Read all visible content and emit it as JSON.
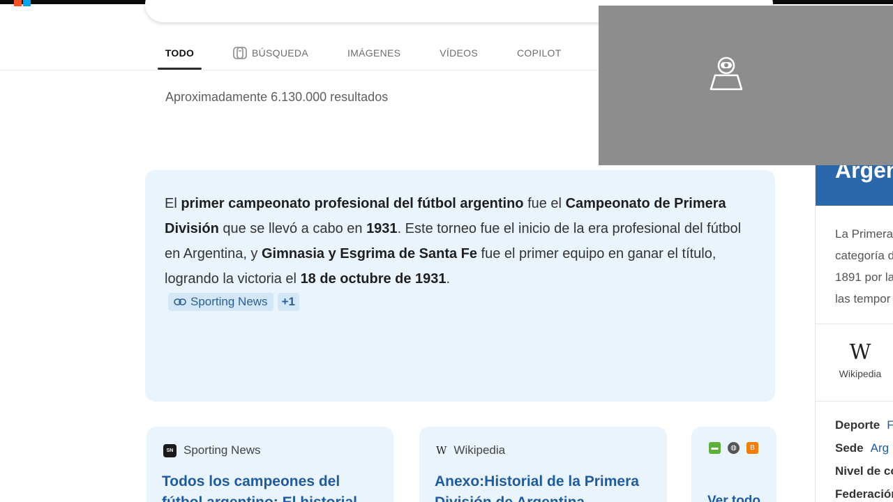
{
  "tabs": {
    "todo": "TODO",
    "busqueda": "BÚSQUEDA",
    "imagenes": "IMÁGENES",
    "videos": "VÍDEOS",
    "copilot": "COPILOT"
  },
  "results_count": "Aproximadamente 6.130.000 resultados",
  "answer": {
    "l1_a": "El ",
    "l1_b": "primer campeonato profesional del fútbol argentino",
    "l1_c": " fue el ",
    "l1_d": "Campeonato de Primera División",
    "l1_e": " que se llevó a cabo en ",
    "l1_f": "1931",
    "l1_g": ". Este torneo fue el inicio de la era profesional del fútbol en Argentina, y ",
    "l1_h": "Gimnasia y Esgrima de Santa Fe",
    "l1_i": " fue el primer equipo en ganar el título, logrando la victoria el ",
    "l1_j": "18 de octubre de 1931",
    "l1_k": ".",
    "citation": "Sporting News",
    "citation_more": "+1"
  },
  "cards": [
    {
      "badge": "SN",
      "source": "Sporting News",
      "title": "Todos los campeones del fútbol argentino: El historial"
    },
    {
      "badge": "W",
      "source": "Wikipedia",
      "title": "Anexo:Historial de la Primera División de Argentina"
    },
    {
      "more": "Ver todo"
    }
  ],
  "knowledge_panel": {
    "title": "Argen",
    "desc": [
      "La Primera",
      "categoría d",
      "1891 por la",
      "las tempor"
    ],
    "wiki_glyph": "W",
    "wiki_label": "Wikipedia",
    "facts": [
      {
        "key": "Deporte",
        "value": "F"
      },
      {
        "key": "Sede",
        "value": "Arg"
      },
      {
        "key": "Nivel de co",
        "value": ""
      },
      {
        "key": "Federación",
        "value": ""
      }
    ]
  },
  "colors": {
    "answer_bg": "#eaf4fd",
    "link": "#1f5c9f",
    "overlay": "#8d8d8d",
    "panel_header": "#2a67ab"
  }
}
